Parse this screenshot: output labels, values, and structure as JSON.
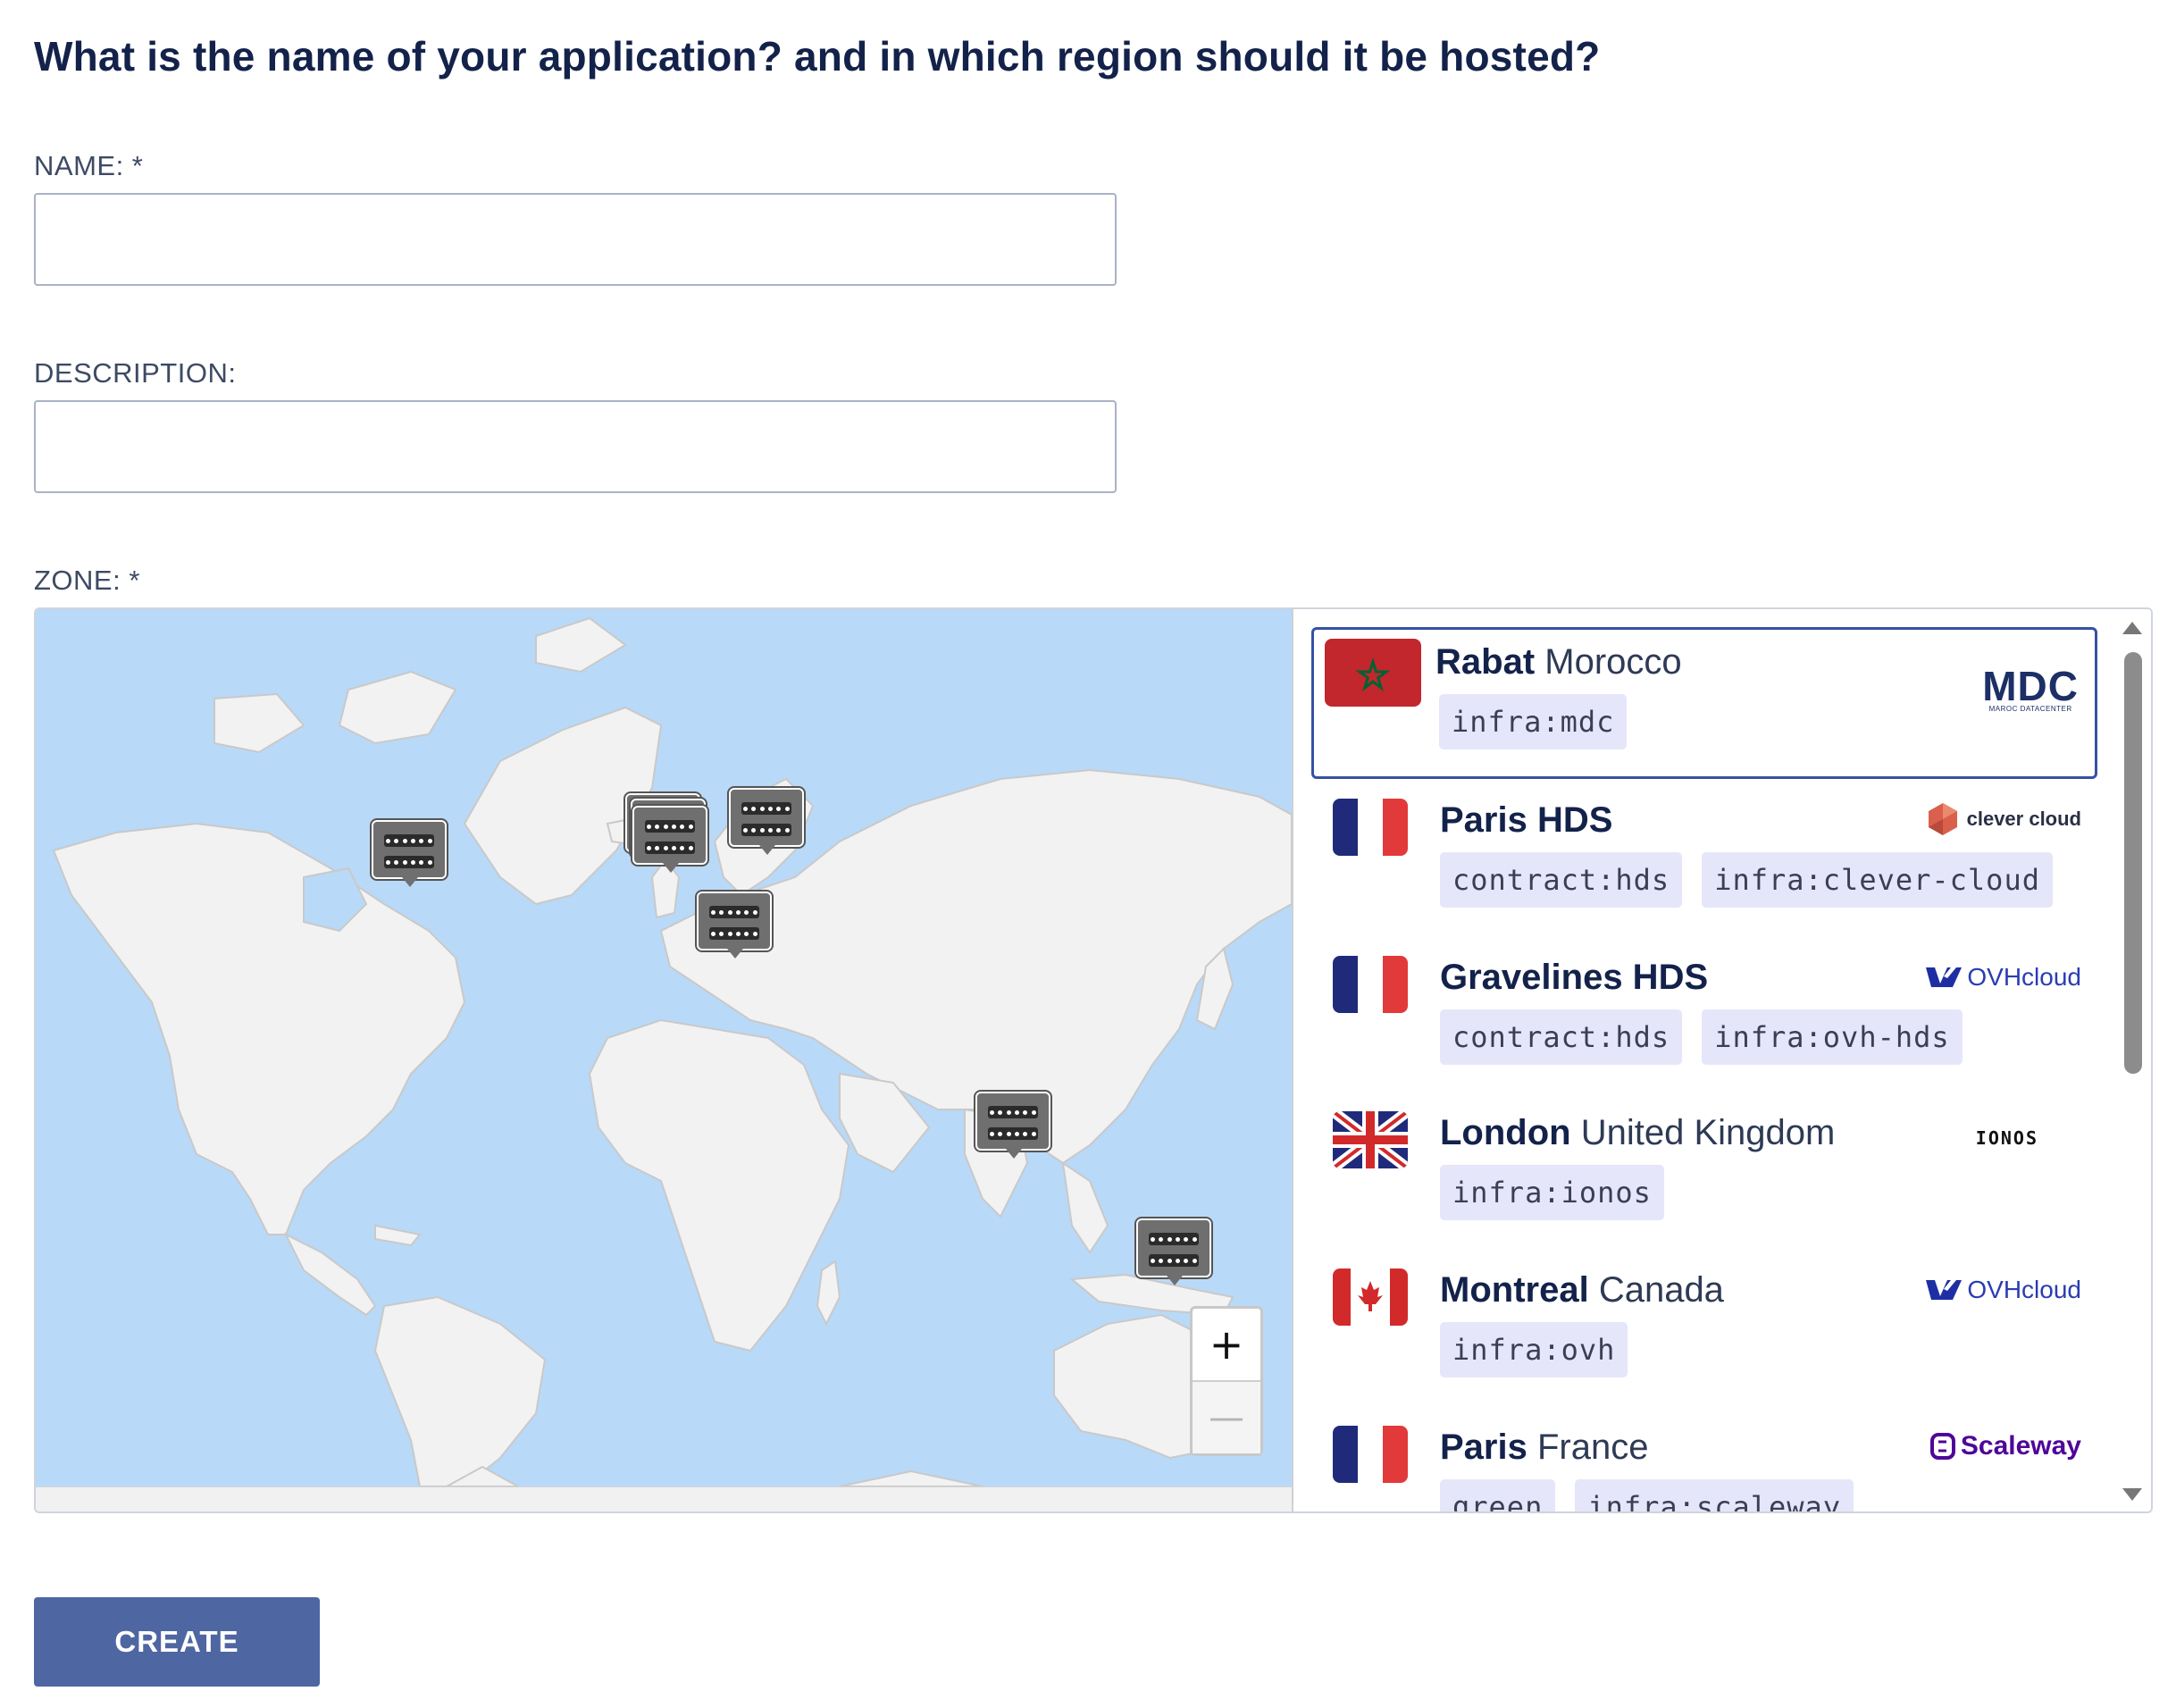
{
  "form": {
    "question": "What is the name of your application? and in which region should it be hosted?",
    "name_label": "NAME: *",
    "name_value": "",
    "description_label": "DESCRIPTION:",
    "description_value": "",
    "zone_label": "ZONE: *",
    "create_label": "CREATE"
  },
  "map": {
    "zoom_in": "+",
    "zoom_out": "—",
    "marker_icon": "server-cluster-icon"
  },
  "zones": [
    {
      "city": "Rabat",
      "country": "Morocco",
      "flag": "morocco",
      "tags": [
        "infra:mdc"
      ],
      "provider": "MDC",
      "provider_sub": "MAROC DATACENTER",
      "selected": true
    },
    {
      "city": "Paris HDS",
      "country": "",
      "flag": "france",
      "tags": [
        "contract:hds",
        "infra:clever-cloud"
      ],
      "provider": "clever cloud"
    },
    {
      "city": "Gravelines HDS",
      "country": "",
      "flag": "france",
      "tags": [
        "contract:hds",
        "infra:ovh-hds"
      ],
      "provider": "OVHcloud"
    },
    {
      "city": "London",
      "country": "United Kingdom",
      "flag": "uk",
      "tags": [
        "infra:ionos"
      ],
      "provider": "IONOS"
    },
    {
      "city": "Montreal",
      "country": "Canada",
      "flag": "canada",
      "tags": [
        "infra:ovh"
      ],
      "provider": "OVHcloud"
    },
    {
      "city": "Paris",
      "country": "France",
      "flag": "france",
      "tags": [
        "green",
        "infra:scaleway"
      ],
      "provider": "Scaleway"
    }
  ],
  "colors": {
    "accent": "#3452a3",
    "button": "#4e66a2",
    "tag_bg": "#e6e6fa",
    "map_water": "#b9d9f8",
    "map_land": "#f2f2f2"
  }
}
